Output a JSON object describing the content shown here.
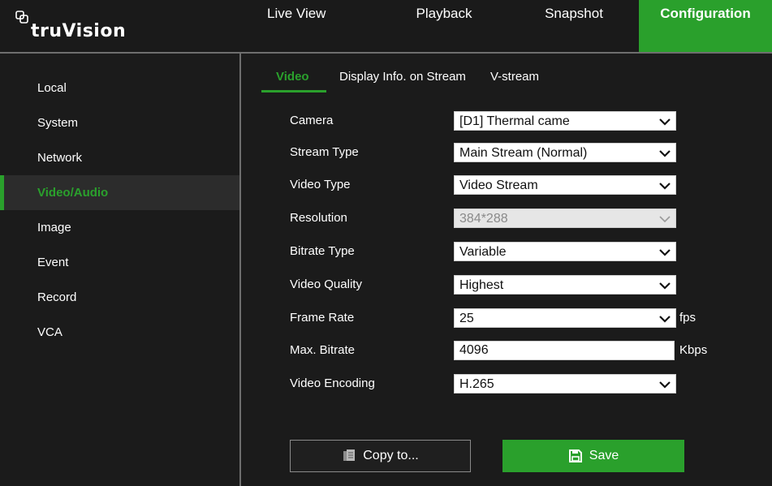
{
  "app": {
    "logo_text": "truVision",
    "logo_icon": "truvision-mark-icon"
  },
  "nav": {
    "items": [
      {
        "label": "Live View"
      },
      {
        "label": "Playback"
      },
      {
        "label": "Snapshot"
      },
      {
        "label": "Configuration"
      }
    ],
    "active": "Configuration"
  },
  "sidebar": {
    "items": [
      {
        "label": "Local"
      },
      {
        "label": "System"
      },
      {
        "label": "Network"
      },
      {
        "label": "Video/Audio"
      },
      {
        "label": "Image"
      },
      {
        "label": "Event"
      },
      {
        "label": "Record"
      },
      {
        "label": "VCA"
      }
    ],
    "active": "Video/Audio"
  },
  "tabs": {
    "items": [
      {
        "label": "Video"
      },
      {
        "label": "Display Info. on Stream"
      },
      {
        "label": "V-stream"
      }
    ],
    "active": "Video"
  },
  "form": {
    "camera": {
      "label": "Camera",
      "value": "[D1] Thermal came"
    },
    "stream_type": {
      "label": "Stream Type",
      "value": "Main Stream (Normal)"
    },
    "video_type": {
      "label": "Video Type",
      "value": "Video Stream"
    },
    "resolution": {
      "label": "Resolution",
      "value": "384*288"
    },
    "bitrate_type": {
      "label": "Bitrate Type",
      "value": "Variable"
    },
    "video_quality": {
      "label": "Video Quality",
      "value": "Highest"
    },
    "frame_rate": {
      "label": "Frame Rate",
      "value": "25",
      "unit": "fps"
    },
    "max_bitrate": {
      "label": "Max. Bitrate",
      "value": "4096",
      "unit": "Kbps"
    },
    "video_encoding": {
      "label": "Video Encoding",
      "value": "H.265"
    }
  },
  "buttons": {
    "copy": {
      "label": "Copy to...",
      "icon": "copy-icon"
    },
    "save": {
      "label": "Save",
      "icon": "floppy-disk-icon"
    }
  },
  "colors": {
    "accent": "#2aa02c",
    "background": "#1b1b1b",
    "active_item_bg": "#2c2c2c",
    "divider": "#6e6e6e"
  }
}
